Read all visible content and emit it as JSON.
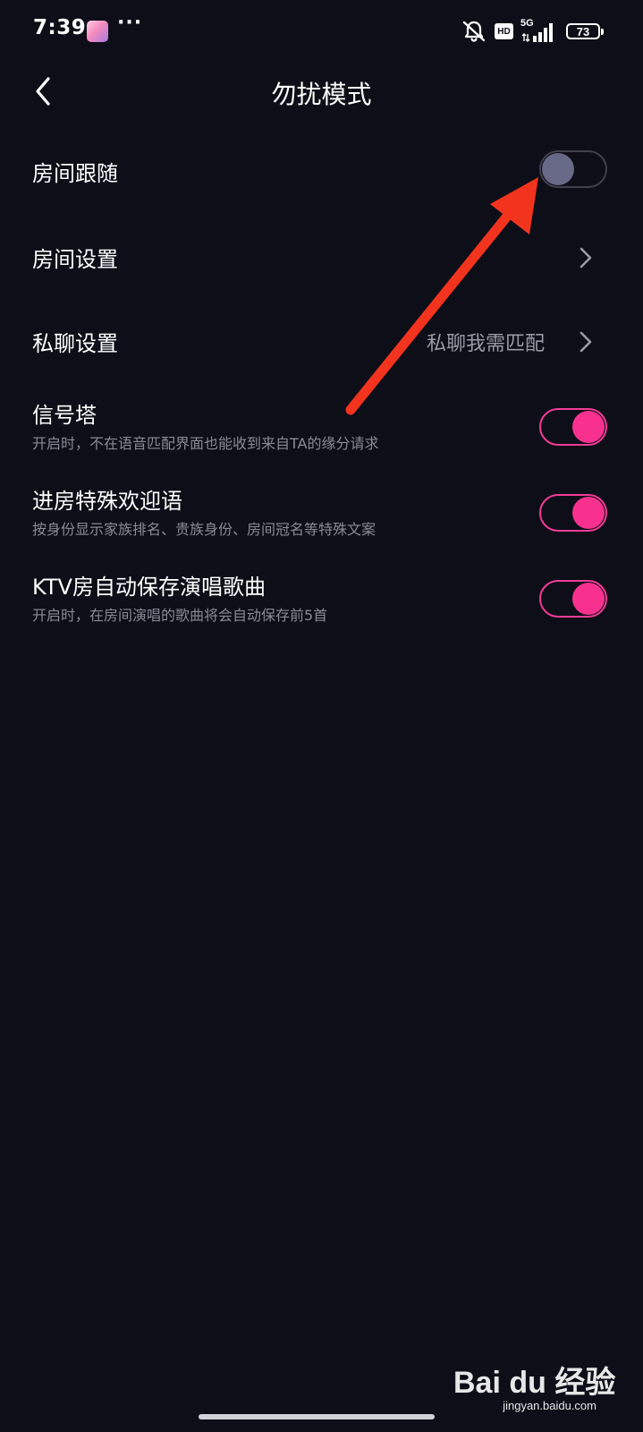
{
  "status_bar": {
    "time": "7:39",
    "more": "···",
    "hd": "HD",
    "network": "5G",
    "battery": "73"
  },
  "header": {
    "title": "勿扰模式"
  },
  "settings": {
    "room_follow": {
      "label": "房间跟随",
      "toggle_on": false
    },
    "room_settings": {
      "label": "房间设置"
    },
    "private_chat": {
      "label": "私聊设置",
      "value": "私聊我需匹配"
    },
    "signal_tower": {
      "label": "信号塔",
      "subtitle": "开启时，不在语音匹配界面也能收到来自TA的缘分请求",
      "toggle_on": true
    },
    "welcome_message": {
      "label": "进房特殊欢迎语",
      "subtitle": "按身份显示家族排名、贵族身份、房间冠名等特殊文案",
      "toggle_on": true
    },
    "ktv_autosave": {
      "label": "KTV房自动保存演唱歌曲",
      "subtitle": "开启时，在房间演唱的歌曲将会自动保存前5首",
      "toggle_on": true
    }
  },
  "watermark": {
    "logo": "Bai du 经验",
    "url": "jingyan.baidu.com"
  },
  "colors": {
    "background": "#0e0e18",
    "accent": "#f8318f",
    "toggle_off_knob": "#686887",
    "annotation_arrow": "#f2341f"
  }
}
